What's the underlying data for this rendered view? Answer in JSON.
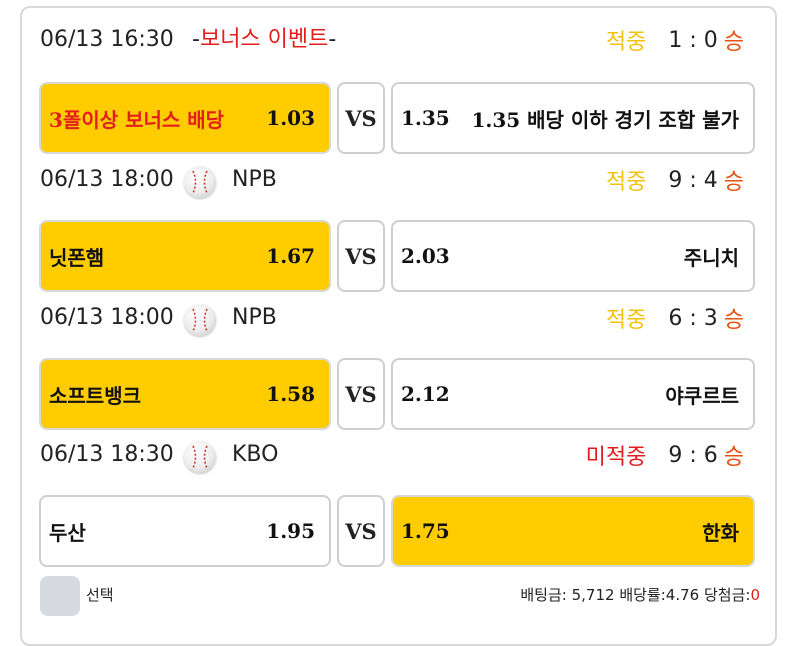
{
  "matches": [
    {
      "time": "06/13 16:30",
      "event_prefix": "-",
      "event_name": "보너스 이벤트",
      "event_suffix": "-",
      "status": "적중",
      "score": "1 : 0",
      "outcome": "승",
      "home": {
        "name": "3폴이상 보너스 배당",
        "odd": "1.03",
        "selected": true
      },
      "vs": "VS",
      "away": {
        "name": "1.35 배당 이하 경기 조합 불가",
        "odd": "1.35",
        "selected": false
      }
    },
    {
      "time": "06/13 18:00",
      "sport_icon": "baseball-icon",
      "league": "NPB",
      "status": "적중",
      "score": "9 : 4",
      "outcome": "승",
      "home": {
        "name": "닛폰햄",
        "odd": "1.67",
        "selected": true
      },
      "vs": "VS",
      "away": {
        "name": "주니치",
        "odd": "2.03",
        "selected": false
      }
    },
    {
      "time": "06/13 18:00",
      "sport_icon": "baseball-icon",
      "league": "NPB",
      "status": "적중",
      "score": "6 : 3",
      "outcome": "승",
      "home": {
        "name": "소프트뱅크",
        "odd": "1.58",
        "selected": true
      },
      "vs": "VS",
      "away": {
        "name": "야쿠르트",
        "odd": "2.12",
        "selected": false
      }
    },
    {
      "time": "06/13 18:30",
      "sport_icon": "baseball-icon",
      "league": "KBO",
      "status": "미적중",
      "score": "9 : 6",
      "outcome": "승",
      "home": {
        "name": "두산",
        "odd": "1.95",
        "selected": false
      },
      "vs": "VS",
      "away": {
        "name": "한화",
        "odd": "1.75",
        "selected": true
      }
    }
  ],
  "footer": {
    "select_label": "선택",
    "bet_amount_label": "배팅금: ",
    "bet_amount": "5,712",
    "odds_label": "배당률:",
    "odds": "4.76",
    "payout_label": "당첨금:",
    "payout": "0"
  },
  "colors": {
    "selected": "#ffcc00",
    "hit": "#f4c20d",
    "miss": "#e31e1e",
    "win": "#e8500f"
  }
}
